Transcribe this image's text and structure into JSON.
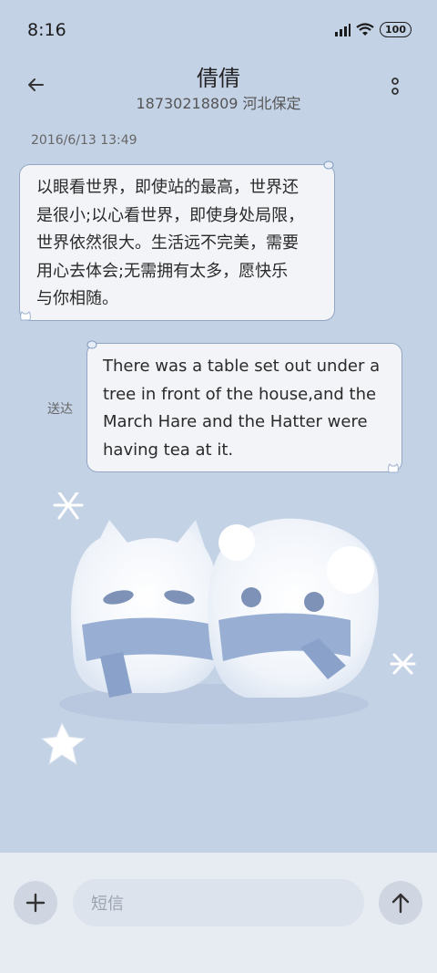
{
  "status_bar": {
    "time": "8:16",
    "battery": "100"
  },
  "header": {
    "name": "倩倩",
    "subtitle": "18730218809 河北保定"
  },
  "conversation": {
    "timestamp": "2016/6/13 13:49",
    "incoming": {
      "lines": [
        "以眼看世界，即使站的最高，世界还",
        "是很小;以心看世界，即使身处局限，",
        "世界依然很大。生活远不完美，需要",
        "用心去体会;无需拥有太多，愿快乐",
        "与你相随。"
      ]
    },
    "outgoing": {
      "lines": [
        "There was a table set out under a",
        "tree in front of the house,and the",
        "March Hare and the Hatter were",
        "having tea at it."
      ],
      "status": "送达"
    }
  },
  "composer": {
    "placeholder": "短信"
  },
  "icons": {
    "back": "arrow-left-icon",
    "more": "more-vertical-icon",
    "add": "plus-icon",
    "send": "arrow-up-icon"
  },
  "colors": {
    "background": "#c4d2e6",
    "bubble": "#f3f4f8",
    "bubble_border": "#93a7c3"
  }
}
